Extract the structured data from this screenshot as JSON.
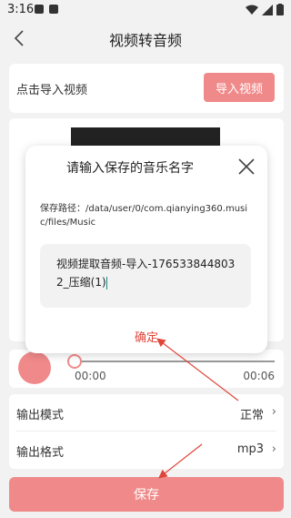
{
  "status_bar": {
    "time": "3:16"
  },
  "nav": {
    "title": "视频转音频"
  },
  "import": {
    "label": "点击导入视频",
    "button_label": "导入视频"
  },
  "player": {
    "current_time": "00:00",
    "total_time": "00:06",
    "progress": 0.0
  },
  "settings": {
    "output_mode_label": "输出模式",
    "output_mode_value": "正常",
    "output_format_label": "输出格式",
    "output_format_value": "mp3"
  },
  "save_button_label": "保存",
  "dialog": {
    "title": "请输入保存的音乐名字",
    "save_path_label": "保存路径：/data/user/0/com.qianying360.music/files/Music",
    "input_value": "视频提取音频-导入-1765338448032_压缩(1)",
    "confirm_label": "确定"
  },
  "colors": {
    "accent": "#f08a8a",
    "confirm_text": "#e0453a",
    "annotation_arrow": "#e0453a"
  }
}
